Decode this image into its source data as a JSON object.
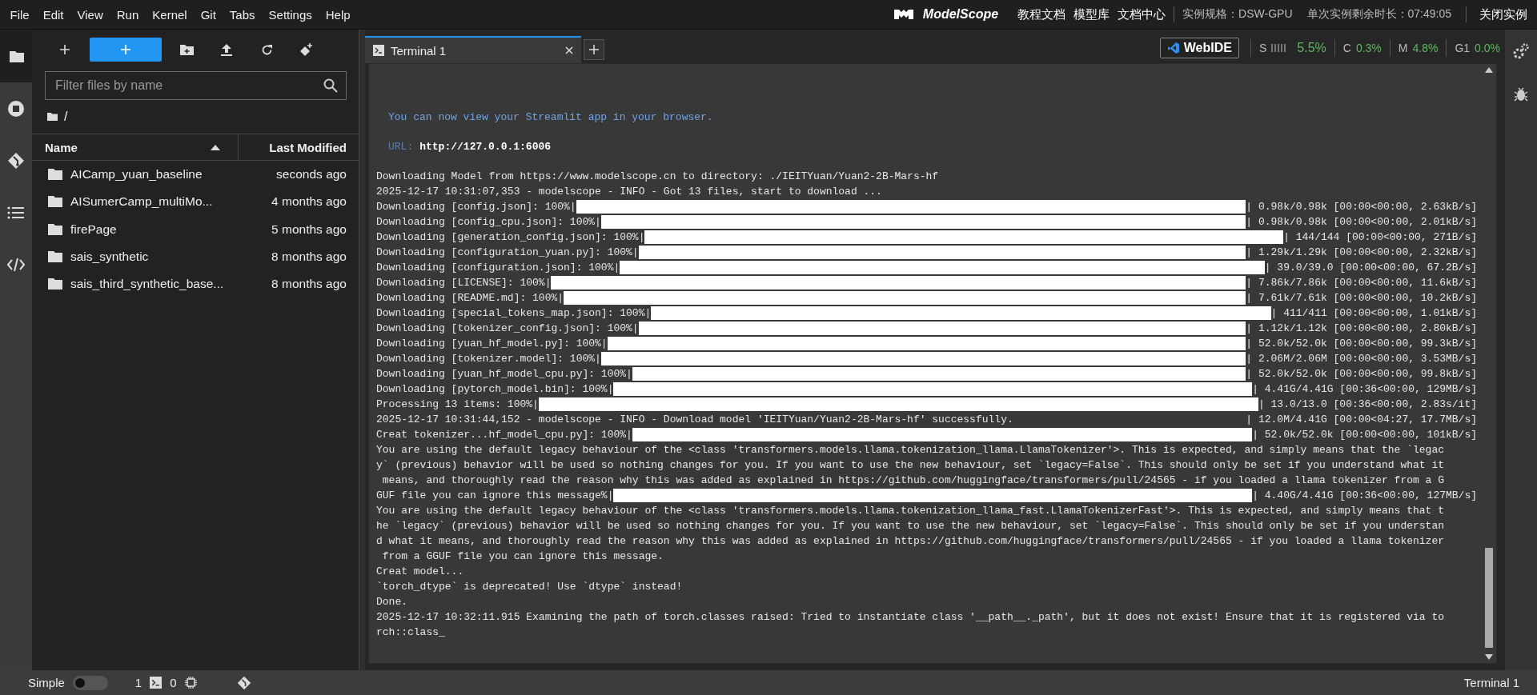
{
  "menu_bar": {
    "items": [
      "File",
      "Edit",
      "View",
      "Run",
      "Kernel",
      "Git",
      "Tabs",
      "Settings",
      "Help"
    ],
    "logo": "ModelScope",
    "links": [
      "教程文档",
      "模型库",
      "文档中心"
    ],
    "instance_spec": "实例规格：DSW-GPU",
    "remaining_time": "单次实例剩余时长：07:49:05",
    "close_button": "关闭实例"
  },
  "left_sidebar": {
    "items": [
      {
        "kind": "files",
        "selected": true
      },
      {
        "kind": "running",
        "selected": false
      },
      {
        "kind": "git",
        "selected": false
      },
      {
        "kind": "toc",
        "selected": false
      },
      {
        "kind": "extensions",
        "selected": false
      }
    ]
  },
  "file_browser": {
    "filter": {
      "placeholder": "Filter files by name"
    },
    "path": "/",
    "columns": [
      {
        "label": "Name",
        "sorted": true
      },
      {
        "label": "Last Modified",
        "sorted": false
      }
    ],
    "rows": [
      {
        "name": "AICamp_yuan_baseline",
        "modified": "seconds ago"
      },
      {
        "name": "AISumerCamp_multiMo...",
        "modified": "4 months ago"
      },
      {
        "name": "firePage",
        "modified": "5 months ago"
      },
      {
        "name": "sais_synthetic",
        "modified": "8 months ago"
      },
      {
        "name": "sais_third_synthetic_base...",
        "modified": "8 months ago"
      }
    ]
  },
  "tabs": [
    {
      "label": "Terminal 1",
      "selected": true
    }
  ],
  "resource_monitor": {
    "button": "WebIDE",
    "metrics": [
      {
        "kind": "meter",
        "label": "S",
        "value": "5.5%"
      },
      {
        "kind": "text",
        "label": "C",
        "value": "0.3%"
      },
      {
        "kind": "text",
        "label": "M",
        "value": "4.8%"
      },
      {
        "kind": "text",
        "label": "G1",
        "value": "0.0%"
      }
    ]
  },
  "terminal": {
    "lines": [
      {
        "kind": "notice",
        "text": "You can now view your Streamlit app in your browser."
      },
      {
        "kind": "url",
        "label": "URL:",
        "value": "http://127.0.0.1:6006"
      },
      {
        "kind": "text",
        "text": "Downloading Model from https://www.modelscope.cn to directory: ./IEITYuan/Yuan2-2B-Mars-hf"
      },
      {
        "kind": "text",
        "text": "2025-12-17 10:31:07,353 - modelscope - INFO - Got 13 files, start to download ..."
      },
      {
        "kind": "progress",
        "prefix": "Downloading [config.json]: 100%|",
        "level": 1,
        "suffix": "| 0.98k/0.98k [00:00<00:00, 2.63kB/s]"
      },
      {
        "kind": "progress",
        "prefix": "Downloading [config_cpu.json]: 100%|",
        "level": 1,
        "suffix": "| 0.98k/0.98k [00:00<00:00, 2.01kB/s]"
      },
      {
        "kind": "progress",
        "prefix": "Downloading [generation_config.json]: 100%|",
        "level": 1,
        "suffix": "| 144/144 [00:00<00:00, 271B/s]"
      },
      {
        "kind": "progress",
        "prefix": "Downloading [configuration_yuan.py]: 100%|",
        "level": 1,
        "suffix": "| 1.29k/1.29k [00:00<00:00, 2.32kB/s]"
      },
      {
        "kind": "progress",
        "prefix": "Downloading [configuration.json]: 100%|",
        "level": 1,
        "suffix": "| 39.0/39.0 [00:00<00:00, 67.2B/s]"
      },
      {
        "kind": "progress",
        "prefix": "Downloading [LICENSE]: 100%|",
        "level": 1,
        "suffix": "| 7.86k/7.86k [00:00<00:00, 11.6kB/s]"
      },
      {
        "kind": "progress",
        "prefix": "Downloading [README.md]: 100%|",
        "level": 1,
        "suffix": "| 7.61k/7.61k [00:00<00:00, 10.2kB/s]"
      },
      {
        "kind": "progress",
        "prefix": "Downloading [special_tokens_map.json]: 100%|",
        "level": 1,
        "suffix": "| 411/411 [00:00<00:00, 1.01kB/s]"
      },
      {
        "kind": "progress",
        "prefix": "Downloading [tokenizer_config.json]: 100%|",
        "level": 1,
        "suffix": "| 1.12k/1.12k [00:00<00:00, 2.80kB/s]"
      },
      {
        "kind": "progress",
        "prefix": "Downloading [yuan_hf_model.py]: 100%|",
        "level": 1,
        "suffix": "| 52.0k/52.0k [00:00<00:00, 99.3kB/s]"
      },
      {
        "kind": "progress",
        "prefix": "Downloading [tokenizer.model]: 100%|",
        "level": 1,
        "suffix": "| 2.06M/2.06M [00:00<00:00, 3.53MB/s]"
      },
      {
        "kind": "progress",
        "prefix": "Downloading [yuan_hf_model_cpu.py]: 100%|",
        "level": 1,
        "suffix": "| 52.0k/52.0k [00:00<00:00, 99.8kB/s]"
      },
      {
        "kind": "progress",
        "prefix": "Downloading [pytorch_model.bin]: 100%|",
        "level": 1,
        "suffix": "| 4.41G/4.41G [00:36<00:00, 129MB/s]"
      },
      {
        "kind": "progress",
        "prefix": "Processing 13 items: 100%|",
        "level": 1,
        "suffix": "| 13.0/13.0 [00:36<00:00, 2.83s/it]"
      },
      {
        "kind": "status",
        "text": "2025-12-17 10:31:44,152 - modelscope - INFO - Download model 'IEITYuan/Yuan2-2B-Mars-hf' successfully.",
        "stats": "| 12.0M/4.41G [00:00<04:27, 17.7MB/s]"
      },
      {
        "kind": "progress",
        "prefix": "Creat tokenizer...hf_model_cpu.py]: 100%|",
        "level": 1,
        "suffix": "| 52.0k/52.0k [00:00<00:00, 101kB/s]"
      },
      {
        "kind": "text",
        "text": "You are using the default legacy behaviour of the <class 'transformers.models.llama.tokenization_llama.LlamaTokenizer'>. This is expected, and simply means that the `legac"
      },
      {
        "kind": "text",
        "text": "y` (previous) behavior will be used so nothing changes for you. If you want to use the new behaviour, set `legacy=False`. This should only be set if you understand what it"
      },
      {
        "kind": "text",
        "text": " means, and thoroughly read the reason why this was added as explained in https://github.com/huggingface/transformers/pull/24565 - if you loaded a llama tokenizer from a G"
      },
      {
        "kind": "progress",
        "prefix": "GUF file you can ignore this message%|",
        "level": 1,
        "suffix": "| 4.40G/4.41G [00:36<00:00, 127MB/s]"
      },
      {
        "kind": "text",
        "text": "You are using the default legacy behaviour of the <class 'transformers.models.llama.tokenization_llama_fast.LlamaTokenizerFast'>. This is expected, and simply means that t"
      },
      {
        "kind": "text",
        "text": "he `legacy` (previous) behavior will be used so nothing changes for you. If you want to use the new behaviour, set `legacy=False`. This should only be set if you understan"
      },
      {
        "kind": "text",
        "text": "d what it means, and thoroughly read the reason why this was added as explained in https://github.com/huggingface/transformers/pull/24565 - if you loaded a llama tokenizer"
      },
      {
        "kind": "text",
        "text": " from a GGUF file you can ignore this message."
      },
      {
        "kind": "text",
        "text": "Creat model..."
      },
      {
        "kind": "text",
        "text": "`torch_dtype` is deprecated! Use `dtype` instead!"
      },
      {
        "kind": "text",
        "text": "Done."
      },
      {
        "kind": "text",
        "text": "2025-12-17 10:32:11.915 Examining the path of torch.classes raised: Tried to instantiate class '__path__._path', but it does not exist! Ensure that it is registered via to"
      },
      {
        "kind": "text",
        "text": "rch::class_"
      }
    ]
  },
  "status_bar": {
    "mode_label": "Simple",
    "simple_mode": false,
    "terminals": "1",
    "kernels": "0",
    "active": "Terminal 1"
  }
}
